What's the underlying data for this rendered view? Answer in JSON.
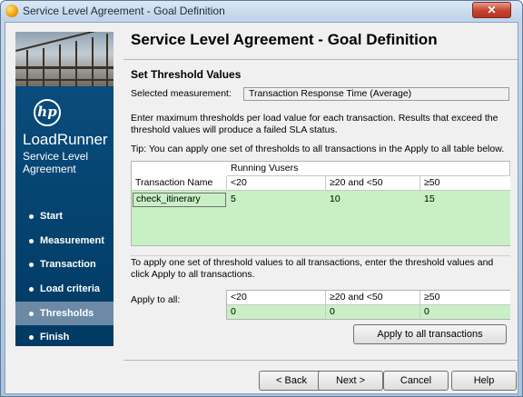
{
  "window": {
    "title": "Service Level Agreement - Goal Definition",
    "close_label": "✕"
  },
  "sidebar": {
    "logo_text": "hp",
    "product": "LoadRunner",
    "subtitle": "Service Level Agreement",
    "items": [
      {
        "label": "Start"
      },
      {
        "label": "Measurement"
      },
      {
        "label": "Transaction"
      },
      {
        "label": "Load criteria"
      },
      {
        "label": "Thresholds"
      },
      {
        "label": "Finish"
      }
    ],
    "active_index": 4
  },
  "header": {
    "title": "Service Level Agreement - Goal Definition"
  },
  "main": {
    "section_title": "Set Threshold Values",
    "measurement_label": "Selected measurement:",
    "measurement_value": "Transaction Response Time (Average)",
    "description": "Enter maximum thresholds per load value for each transaction. Results that exceed the threshold values will produce a failed SLA status.",
    "tip": "Tip: You can apply one set of thresholds to all transactions in the Apply to all table below.",
    "table": {
      "group_header": "Running Vusers",
      "name_header": "Transaction Name",
      "columns": [
        "<20",
        "≥20 and <50",
        "≥50"
      ],
      "rows": [
        {
          "name": "check_itinerary",
          "values": [
            "5",
            "10",
            "15"
          ]
        }
      ]
    },
    "apply_description": "To apply one set of threshold values to all transactions, enter the threshold values and click Apply to all transactions.",
    "apply_label": "Apply to all:",
    "apply_table": {
      "columns": [
        "<20",
        "≥20 and <50",
        "≥50"
      ],
      "values": [
        "0",
        "0",
        "0"
      ]
    },
    "apply_button": "Apply to all transactions"
  },
  "footer": {
    "back": "< Back",
    "next": "Next >",
    "cancel": "Cancel",
    "help": "Help"
  }
}
